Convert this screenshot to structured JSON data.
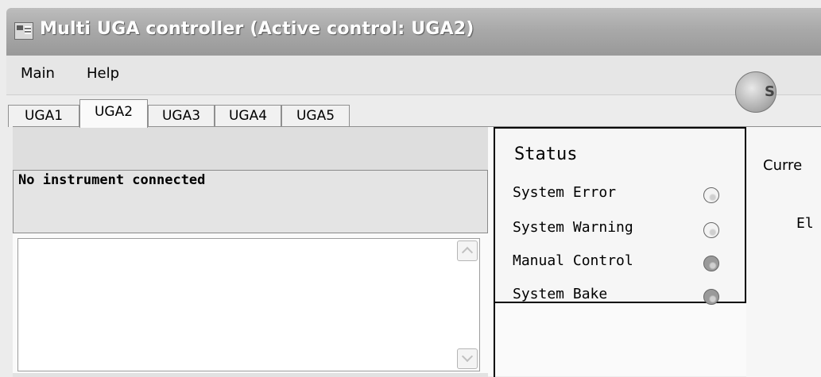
{
  "window": {
    "title": "Multi UGA controller  (Active control: UGA2)"
  },
  "menu": {
    "items": [
      "Main",
      "Help"
    ]
  },
  "tabs": {
    "items": [
      "UGA1",
      "UGA2",
      "UGA3",
      "UGA4",
      "UGA5"
    ],
    "active": "UGA2"
  },
  "instrument": {
    "message": "No instrument connected"
  },
  "status": {
    "title": "Status",
    "indicators": [
      {
        "label": "System Error",
        "state": "off"
      },
      {
        "label": "System Warning",
        "state": "off"
      },
      {
        "label": "Manual Control",
        "state": "on"
      },
      {
        "label": "System Bake",
        "state": "on"
      }
    ]
  },
  "right_panel": {
    "button_text_fragment": "S",
    "current_label": "Curre",
    "el_label": "El"
  },
  "colors": {
    "titlebar": "#a9a9a9",
    "panel_border": "#000000",
    "led_on": "#9a9a9a",
    "led_off": "#f3f3f3"
  }
}
